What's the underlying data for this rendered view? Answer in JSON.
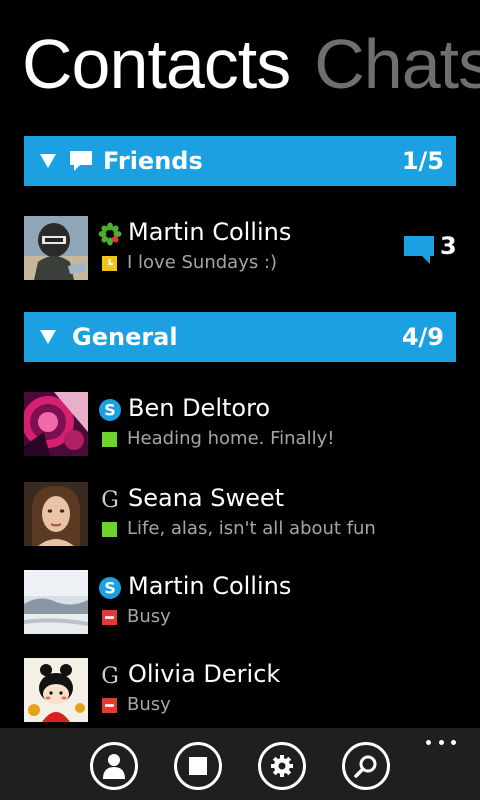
{
  "pivot": {
    "active_title": "Contacts",
    "next_title": "Chats"
  },
  "groups": [
    {
      "title": "Friends",
      "count": "1/5",
      "icon": "chat-bubble-icon",
      "expanded": true,
      "contacts": [
        {
          "name": "Martin Collins",
          "service": "icq",
          "status_color": "#f0c419",
          "status_icon": "away-clock-icon",
          "status_text": "I love Sundays :)",
          "unread_count": "3"
        }
      ]
    },
    {
      "title": "General",
      "count": "4/9",
      "expanded": true,
      "contacts": [
        {
          "name": "Ben Deltoro",
          "service": "skype",
          "status_color": "#6dd42b",
          "status_text": "Heading home. Finally!"
        },
        {
          "name": "Seana Sweet",
          "service": "google-talk",
          "status_color": "#6dd42b",
          "status_text": "Life, alas, isn't all about fun"
        },
        {
          "name": "Martin Collins",
          "service": "skype",
          "status_color": "#e53935",
          "status_text": "Busy"
        },
        {
          "name": "Olivia Derick",
          "service": "google-talk",
          "status_color": "#e53935",
          "status_text": "Busy"
        }
      ]
    }
  ],
  "appbar": {
    "buttons": [
      {
        "icon": "person-icon"
      },
      {
        "icon": "stop-icon"
      },
      {
        "icon": "settings-gear-icon"
      },
      {
        "icon": "search-icon"
      }
    ],
    "more": "more-ellipsis-icon"
  },
  "colors": {
    "accent": "#1ba1e2",
    "background": "#000000",
    "inactive_text": "#6f6f6f",
    "secondary_text": "#a6a6a6",
    "appbar": "#1f1f1f"
  }
}
